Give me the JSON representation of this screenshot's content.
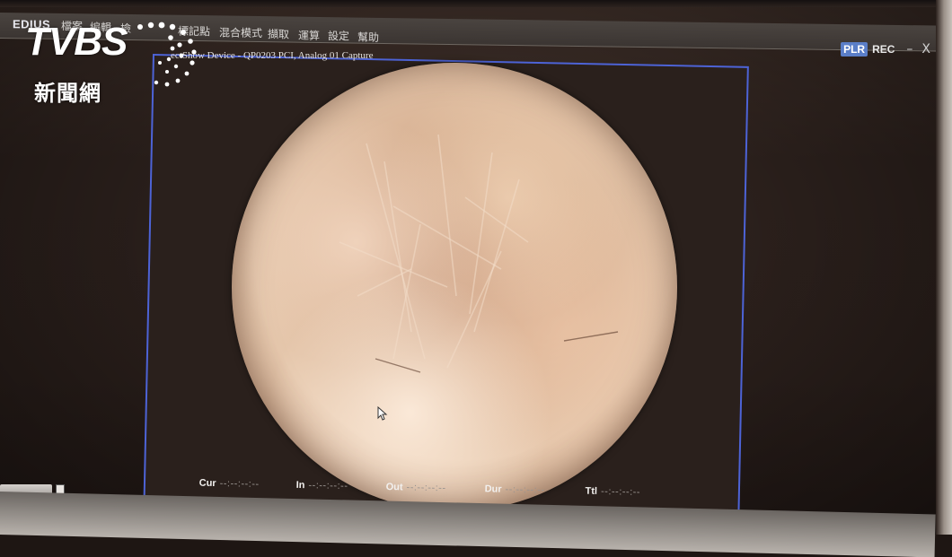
{
  "app": {
    "name": "EDIUS"
  },
  "menu": [
    {
      "label": "檔案"
    },
    {
      "label": "編輯"
    },
    {
      "label": "檢"
    },
    {
      "label": "標記點"
    },
    {
      "label": "混合模式"
    },
    {
      "label": "擷取"
    },
    {
      "label": "運算"
    },
    {
      "label": "設定"
    },
    {
      "label": "幫助"
    }
  ],
  "preview": {
    "title": "ectShow Device - QP0203 PCI, Analog 01 Capture"
  },
  "mode": {
    "plr": "PLR",
    "rec": "REC",
    "minimize": "–",
    "close": "X"
  },
  "timecodes": [
    {
      "label": "Cur",
      "value": "--:--:--:--"
    },
    {
      "label": "In",
      "value": "--:--:--:--"
    },
    {
      "label": "Out",
      "value": "--:--:--:--"
    },
    {
      "label": "Dur",
      "value": "--:--:--:--"
    },
    {
      "label": "Ttl",
      "value": "--:--:--:--"
    }
  ],
  "watermark": {
    "brand": "TVBS",
    "sub": "新聞網"
  },
  "colors": {
    "frame_border": "#4d63d6",
    "plr_badge": "#5a7ec8"
  }
}
